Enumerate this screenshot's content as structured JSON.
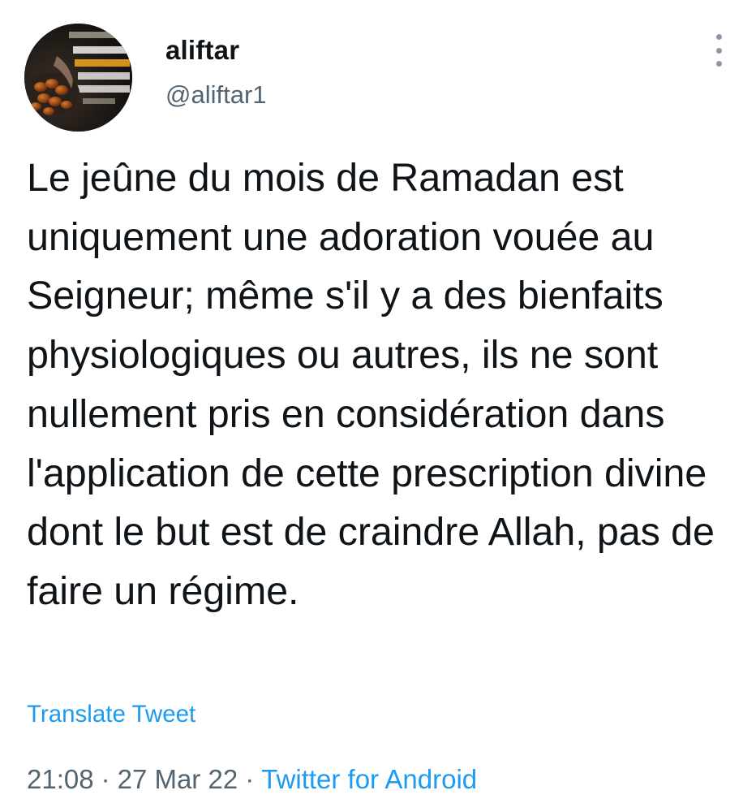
{
  "tweet": {
    "author": {
      "display_name": "aliftar",
      "handle": "@aliftar1",
      "avatar_icon": "avatar-image-dates-bowl"
    },
    "more_icon": "vertical-ellipsis-icon",
    "text": "Le jeûne du mois de Ramadan est uniquement une adoration vouée au Seigneur; même s'il y a des bienfaits physiologiques ou autres, ils ne sont nullement pris en considération dans l'application de cette prescription divine dont le but est de craindre Allah, pas de faire un régime.",
    "translate_label": "Translate Tweet",
    "time": "21:08",
    "date": "27 Mar 22",
    "separator": "·",
    "source": "Twitter for Android"
  },
  "colors": {
    "text": "#0f1419",
    "secondary": "#536471",
    "link": "#1d9bf0"
  }
}
